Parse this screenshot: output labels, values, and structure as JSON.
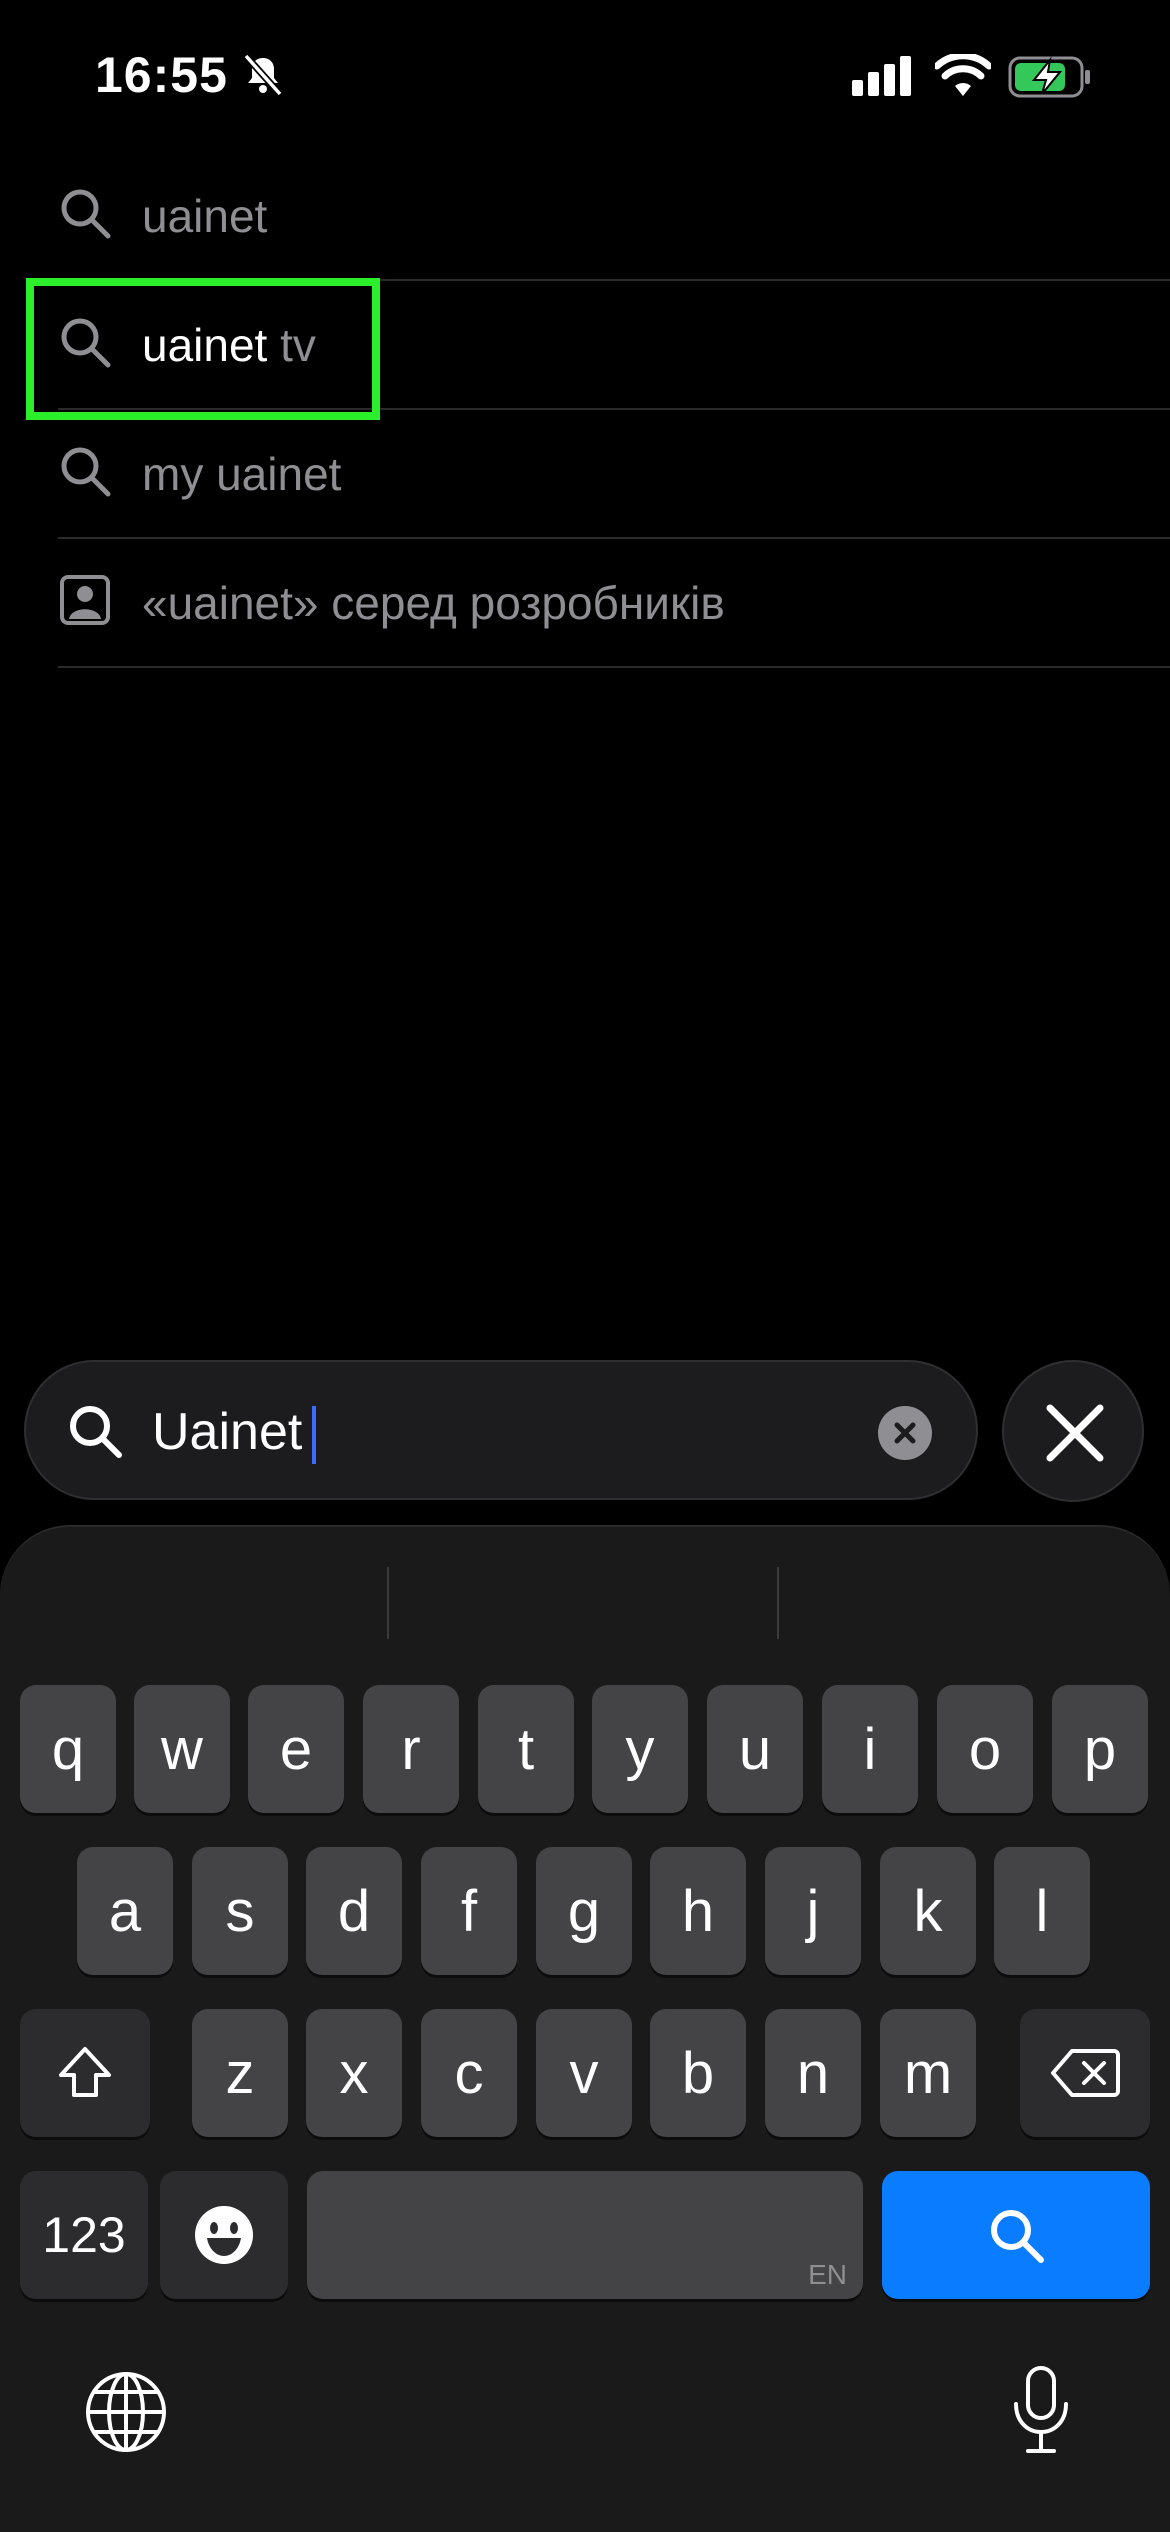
{
  "status_bar": {
    "time": "16:55"
  },
  "suggestions": [
    {
      "type": "search",
      "strong": "",
      "rest": "uainet"
    },
    {
      "type": "search",
      "strong": "uainet",
      "rest": " tv"
    },
    {
      "type": "search",
      "strong": "",
      "rest": "my uainet"
    },
    {
      "type": "developer",
      "strong": "",
      "rest": "«uainet» серед розробників"
    }
  ],
  "search": {
    "value": "Uainet"
  },
  "keyboard": {
    "row1": [
      "q",
      "w",
      "e",
      "r",
      "t",
      "y",
      "u",
      "i",
      "o",
      "p"
    ],
    "row2": [
      "a",
      "s",
      "d",
      "f",
      "g",
      "h",
      "j",
      "k",
      "l"
    ],
    "row3": [
      "z",
      "x",
      "c",
      "v",
      "b",
      "n",
      "m"
    ],
    "numbers_label": "123",
    "space_language": "EN"
  },
  "colors": {
    "highlight": "#2bef2b",
    "accent": "#0a7cff"
  }
}
